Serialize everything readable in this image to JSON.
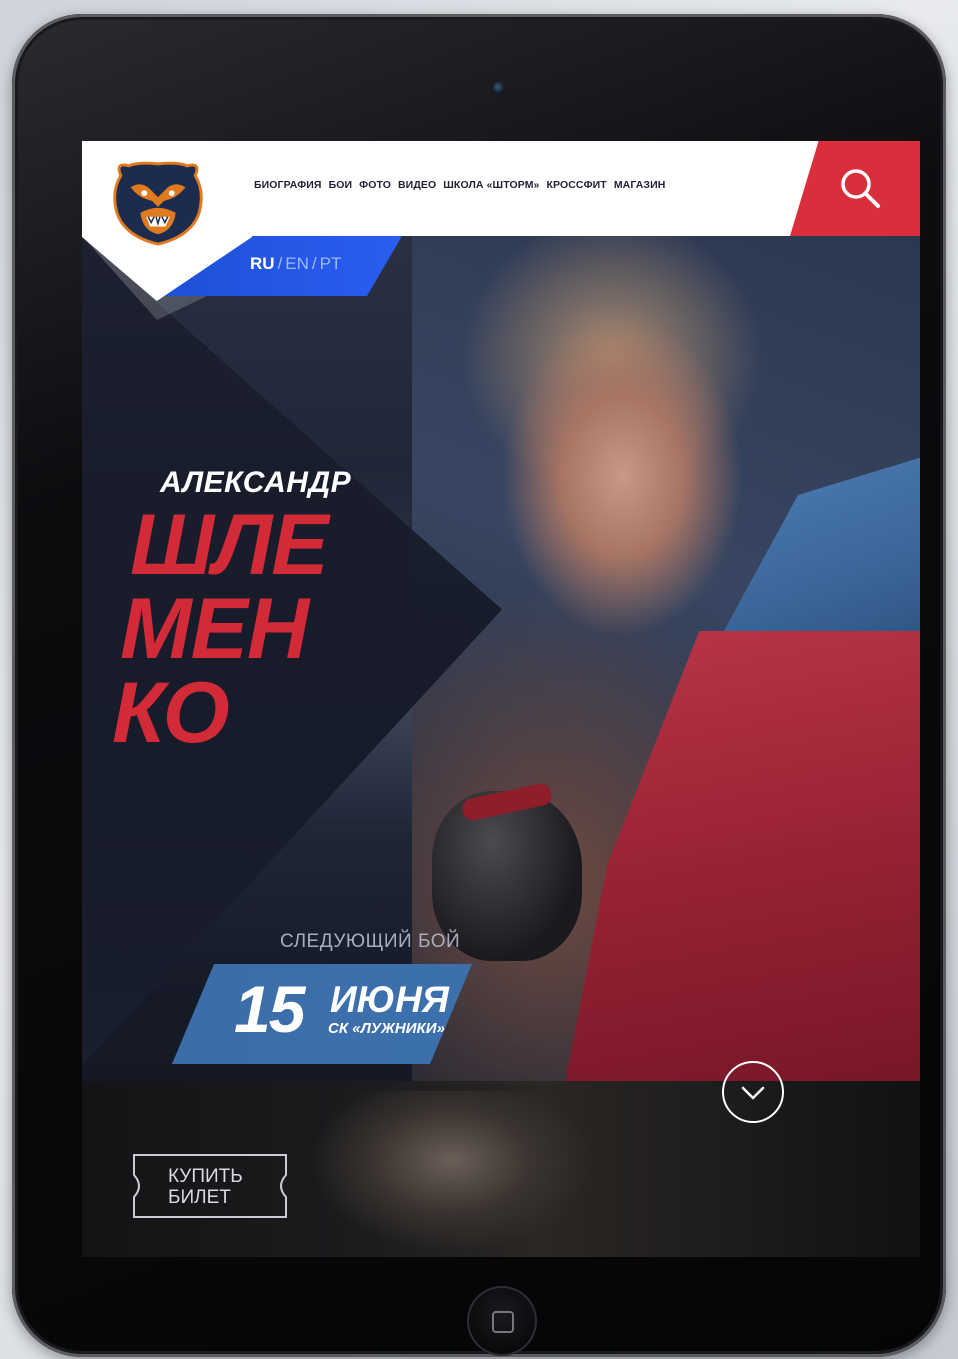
{
  "nav": {
    "items": [
      "БИОГРАФИЯ",
      "БОИ",
      "ФОТО",
      "ВИДЕО",
      "ШКОЛА «ШТОРМ»",
      "КРОССФИТ",
      "МАГАЗИН"
    ]
  },
  "languages": {
    "active": "RU",
    "others": [
      "EN",
      "PT"
    ],
    "separator": "/"
  },
  "hero": {
    "first_name": "АЛЕКСАНДР",
    "last_name_lines": [
      "ШЛЕ",
      "МЕН",
      "КО"
    ]
  },
  "next_fight": {
    "label": "СЛЕДУЮЩИЙ БОЙ",
    "day": "15",
    "month": "ИЮНЯ",
    "venue": "СК «ЛУЖНИКИ»"
  },
  "ticket": {
    "line1": "КУПИТЬ",
    "line2": "БИЛЕТ"
  },
  "icons": {
    "logo": "bear-logo-icon",
    "search": "search-icon",
    "scroll": "chevron-down-icon"
  },
  "colors": {
    "brand_red": "#d92f3c",
    "brand_blue": "#2a5ef0",
    "date_blue": "#3c70ad"
  }
}
